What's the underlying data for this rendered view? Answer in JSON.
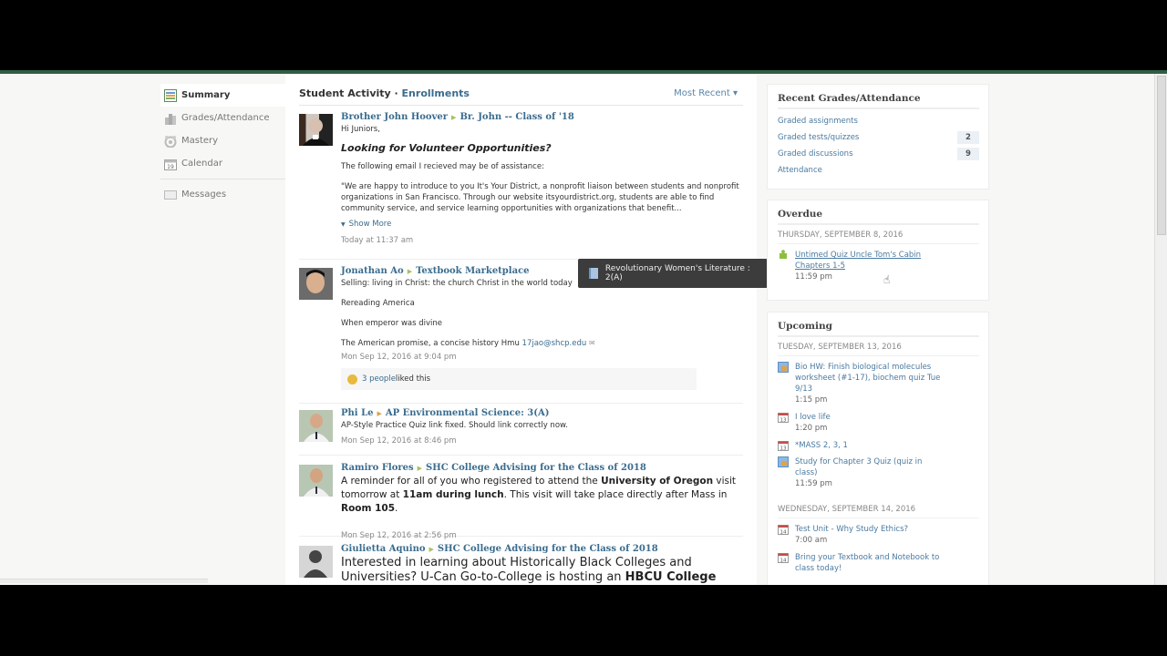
{
  "sidebar": {
    "items": [
      {
        "label": "Summary",
        "icon": "summary-icon",
        "active": true
      },
      {
        "label": "Grades/Attendance",
        "icon": "grades-icon"
      },
      {
        "label": "Mastery",
        "icon": "mastery-icon"
      },
      {
        "label": "Calendar",
        "icon": "calendar-icon"
      },
      {
        "label": "Messages",
        "icon": "messages-icon"
      }
    ]
  },
  "main": {
    "title": "Student Activity",
    "separator": " · ",
    "title_link": "Enrollments",
    "sort_label": "Most Recent ▾"
  },
  "posts": [
    {
      "author": "Brother John Hoover",
      "target": "Br. John -- Class of '18",
      "greeting": "Hi Juniors,",
      "heading": "Looking for Volunteer Opportunities?",
      "line1": "The following email I recieved may be of assistance:",
      "quote": "\"We are happy to introduce to you It's Your District, a nonprofit liaison between students and nonprofit organizations in San Francisco. Through our website itsyourdistrict.org, students are able to find community service, and service learning opportunities with organizations that benefit...",
      "show_more": "Show More",
      "timestamp": "Today at 11:37 am"
    },
    {
      "author": "Jonathan Ao",
      "target": "Textbook Marketplace",
      "line1": "Selling: living in Christ: the church Christ in the world today",
      "line2": "Rereading America",
      "line3": "When emperor was divine",
      "line4": "The American promise, a concise history Hmu ",
      "email": "17jao@shcp.edu",
      "timestamp": "Mon Sep 12, 2016 at 9:04 pm",
      "likes": "3 people",
      "likes_suffix": " liked this"
    },
    {
      "author": "Phi Le",
      "target": "AP Environmental Science: 3(A)",
      "line1": "AP-Style Practice Quiz link fixed.  Should link correctly now.",
      "timestamp": "Mon Sep 12, 2016 at 8:46 pm"
    },
    {
      "author": "Ramiro Flores",
      "target": "SHC College Advising for the Class of 2018",
      "t1": "A reminder for all of you who registered to attend the ",
      "b1": "University of Oregon",
      "t2": " visit tomorrow at ",
      "b2": "11am during lunch",
      "t3": ".  This visit will take place directly after Mass in ",
      "b3": "Room 105",
      "t4": ".",
      "timestamp": "Mon Sep 12, 2016 at 2:56 pm"
    },
    {
      "author": "Giulietta Aquino",
      "target": "SHC College Advising for the Class of 2018",
      "t1": "Interested in learning about Historically Black Colleges and Universities?  U-Can Go-to-College is hosting an ",
      "b1": "HBCU College Fair"
    }
  ],
  "tooltip": {
    "text": "Revolutionary Women's Literature : 2(A)"
  },
  "recent_grades": {
    "title": "Recent Grades/Attendance",
    "rows": [
      {
        "label": "Graded assignments",
        "count": ""
      },
      {
        "label": "Graded tests/quizzes",
        "count": "2"
      },
      {
        "label": "Graded discussions",
        "count": "9"
      },
      {
        "label": "Attendance",
        "count": ""
      }
    ]
  },
  "overdue": {
    "title": "Overdue",
    "date": "THURSDAY, SEPTEMBER 8, 2016",
    "items": [
      {
        "title": "Untimed Quiz Uncle Tom's Cabin Chapters 1-5",
        "time": "11:59 pm"
      }
    ]
  },
  "upcoming": {
    "title": "Upcoming",
    "days": [
      {
        "date": "TUESDAY, SEPTEMBER 13, 2016",
        "items": [
          {
            "title": "Bio HW: Finish biological molecules worksheet (#1-17), biochem quiz Tue 9/13",
            "time": "1:15 pm",
            "icon": "assignment"
          },
          {
            "title": "I love life",
            "time": "1:20 pm",
            "icon": "calendar",
            "day": "13"
          },
          {
            "title": "*MASS 2, 3, 1",
            "time": "",
            "icon": "calendar",
            "day": "13"
          },
          {
            "title": "Study for Chapter 3 Quiz (quiz in class)",
            "time": "11:59 pm",
            "icon": "assignment"
          }
        ]
      },
      {
        "date": "WEDNESDAY, SEPTEMBER 14, 2016",
        "items": [
          {
            "title": "Test Unit - Why Study Ethics?",
            "time": "7:00 am",
            "icon": "calendar",
            "day": "14"
          },
          {
            "title": "Bring your Textbook and Notebook to class today!",
            "time": "",
            "icon": "calendar",
            "day": "14"
          }
        ]
      }
    ]
  }
}
